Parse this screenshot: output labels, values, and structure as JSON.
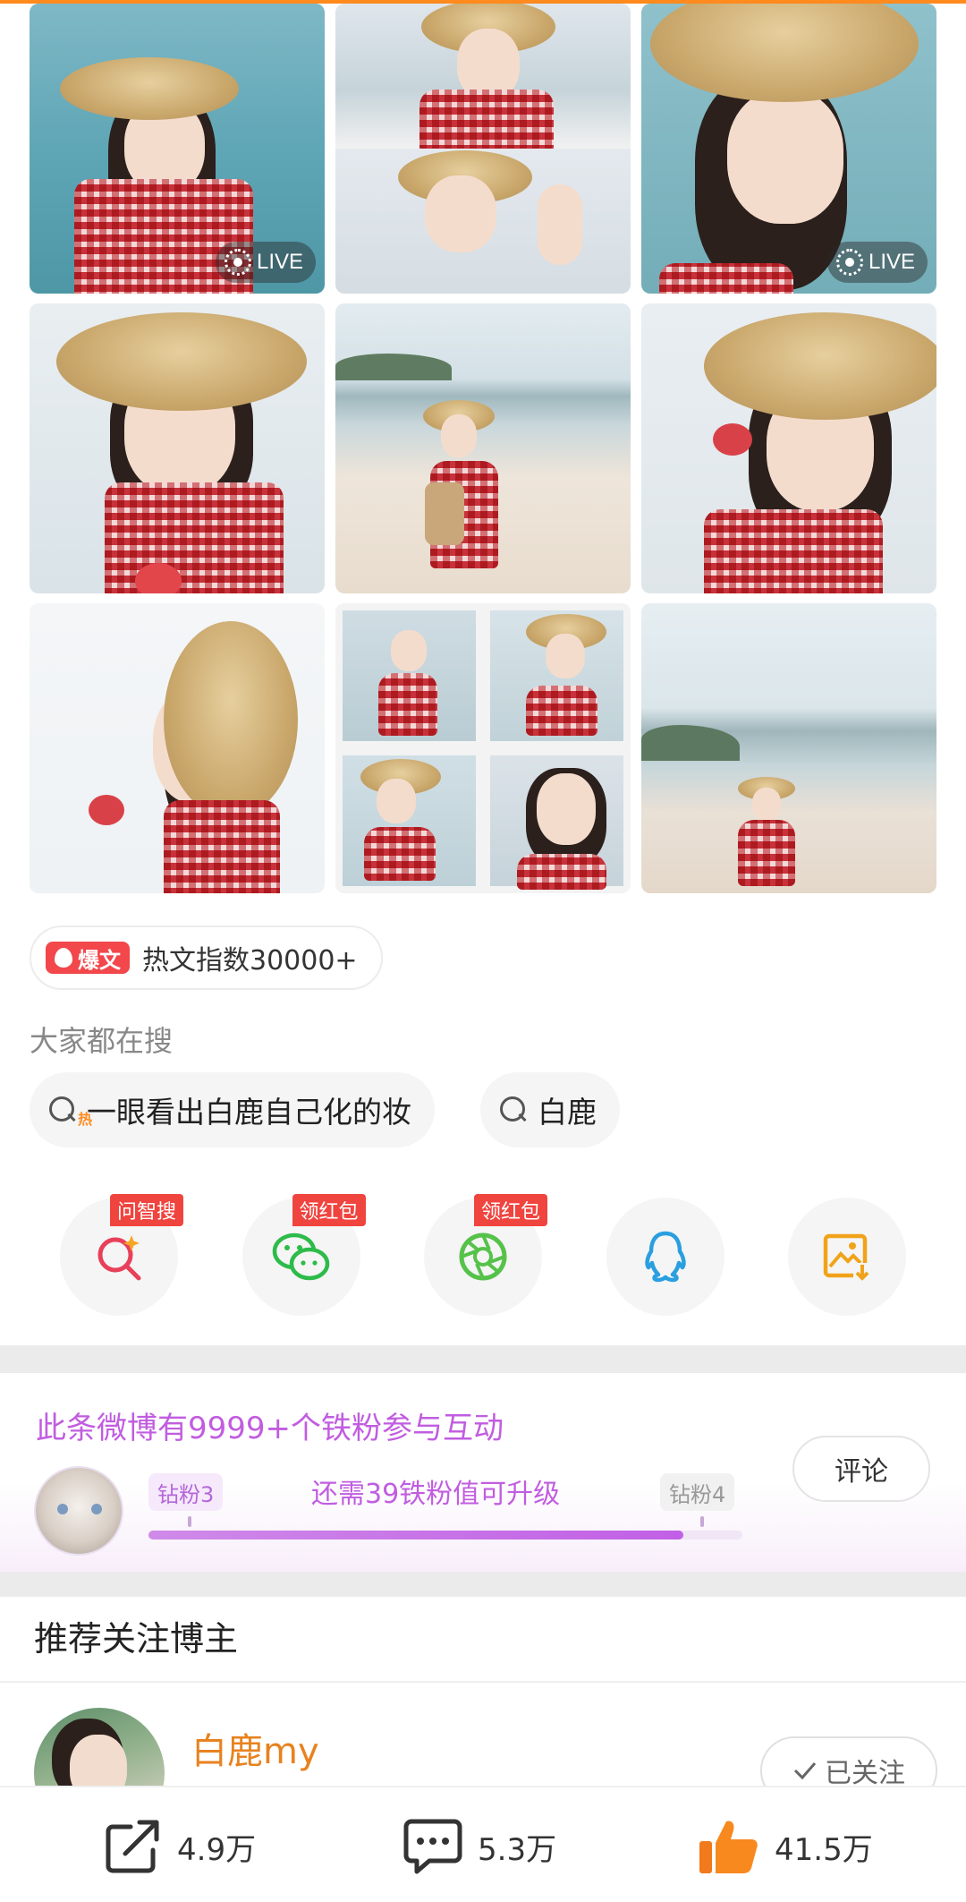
{
  "photos": [
    {
      "name": "photo-1",
      "live": true
    },
    {
      "name": "photo-2",
      "live": false
    },
    {
      "name": "photo-3",
      "live": true
    },
    {
      "name": "photo-4",
      "live": false
    },
    {
      "name": "photo-5",
      "live": false
    },
    {
      "name": "photo-6",
      "live": false
    },
    {
      "name": "photo-7",
      "live": false
    },
    {
      "name": "photo-8",
      "live": false
    },
    {
      "name": "photo-9",
      "live": false
    }
  ],
  "live_label": "LIVE",
  "hot": {
    "tag": "爆文",
    "text": "热文指数30000+"
  },
  "search": {
    "title": "大家都在搜",
    "heat_mark": "热",
    "chips": [
      "一眼看出白鹿自己化的妆",
      "白鹿"
    ]
  },
  "share": {
    "items": [
      {
        "icon": "ai-search-icon",
        "badge": "问智搜",
        "color": "#e8405a"
      },
      {
        "icon": "wechat-icon",
        "badge": "领红包",
        "color": "#2dbb4a"
      },
      {
        "icon": "moments-icon",
        "badge": "领红包",
        "color": "#56c24a"
      },
      {
        "icon": "qq-icon",
        "badge": "",
        "color": "#2a9fe0"
      },
      {
        "icon": "save-image-icon",
        "badge": "",
        "color": "#f0a31a"
      }
    ]
  },
  "fans": {
    "title": "此条微博有9999+个铁粉参与互动",
    "level_current": "钻粉3",
    "level_next": "钻粉4",
    "progress_text": "还需39铁粉值可升级",
    "progress": 0.9,
    "comment_label": "评论"
  },
  "recommend": {
    "title": "推荐关注博主",
    "name": "白鹿my",
    "follow_label": "已关注"
  },
  "bottom": {
    "reposts": "4.9万",
    "comments": "5.3万",
    "likes": "41.5万"
  },
  "colors": {
    "accent": "#ff8a1e",
    "fan_purple": "#c15de0",
    "name_orange": "#e8821f",
    "hot_red": "#f2474b"
  }
}
